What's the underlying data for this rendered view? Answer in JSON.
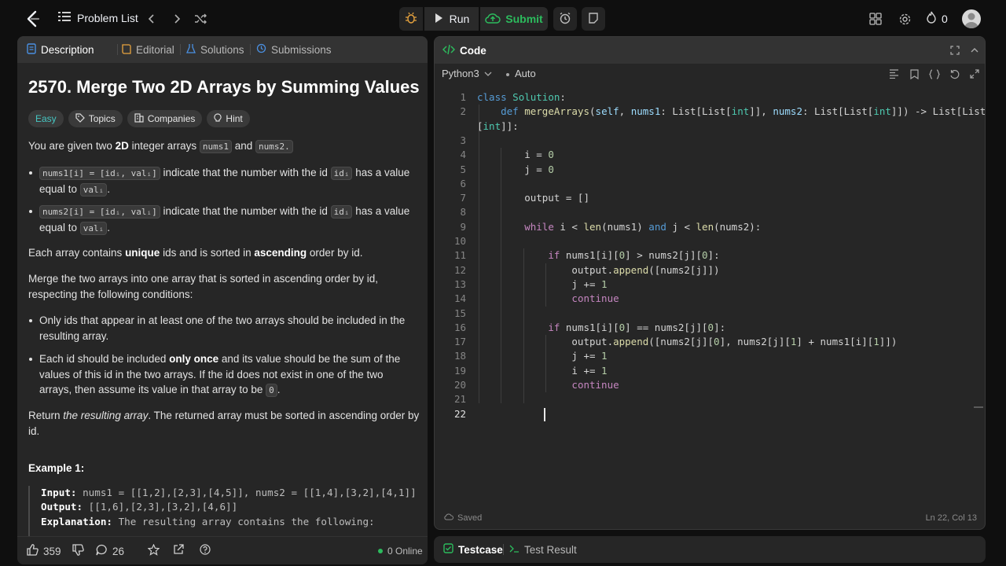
{
  "nav": {
    "problem_list": "Problem List",
    "run_label": "Run",
    "submit_label": "Submit",
    "streak": "0"
  },
  "tabs": {
    "description": "Description",
    "editorial": "Editorial",
    "solutions": "Solutions",
    "submissions": "Submissions"
  },
  "problem": {
    "title": "2570. Merge Two 2D Arrays by Summing Values",
    "difficulty": "Easy",
    "topics": "Topics",
    "companies": "Companies",
    "hint": "Hint",
    "p1_a": "You are given two ",
    "p1_b": "2D",
    "p1_c": " integer arrays ",
    "p1_code1": "nums1",
    "p1_d": " and ",
    "p1_code2": "nums2.",
    "b1_code": "nums1[i] = [idᵢ, valᵢ]",
    "b1_text": " indicate that the number with the id ",
    "b1_code2": "idᵢ",
    "b1_text2": " has a value equal to ",
    "b1_code3": "valᵢ",
    "b1_end": ".",
    "b2_code": "nums2[i] = [idᵢ, valᵢ]",
    "b2_text": " indicate that the number with the id ",
    "b2_code2": "idᵢ",
    "b2_text2": " has a value equal to ",
    "b2_code3": "valᵢ",
    "b2_end": ".",
    "p2_a": "Each array contains ",
    "p2_b": "unique",
    "p2_c": " ids and is sorted in ",
    "p2_d": "ascending",
    "p2_e": " order by id.",
    "p3": "Merge the two arrays into one array that is sorted in ascending order by id, respecting the following conditions:",
    "c1": "Only ids that appear in at least one of the two arrays should be included in the resulting array.",
    "c2_a": "Each id should be included ",
    "c2_b": "only once",
    "c2_c": " and its value should be the sum of the values of this id in the two arrays. If the id does not exist in one of the two arrays, then assume its value in that array to be ",
    "c2_code": "0",
    "c2_end": ".",
    "p4_a": "Return ",
    "p4_b": "the resulting array",
    "p4_c": ". The returned array must be sorted in ascending order by id.",
    "example_title": "Example 1:",
    "ex_input_label": "Input:",
    "ex_input": " nums1 = [[1,2],[2,3],[4,5]], nums2 = [[1,4],[3,2],[4,1]]",
    "ex_output_label": "Output:",
    "ex_output": " [[1,6],[2,3],[3,2],[4,6]]",
    "ex_expl_label": "Explanation:",
    "ex_expl": " The resulting array contains the following:"
  },
  "footer": {
    "likes": "359",
    "comments": "26",
    "online": "0 Online"
  },
  "code_panel": {
    "tab": "Code",
    "language": "Python3",
    "auto": "Auto",
    "saved": "Saved",
    "position": "Ln 22, Col 13"
  },
  "test_panel": {
    "testcase": "Testcase",
    "test_result": "Test Result"
  },
  "code_lines": [
    "1",
    "2",
    "",
    "3",
    "4",
    "5",
    "6",
    "7",
    "8",
    "9",
    "10",
    "11",
    "12",
    "13",
    "14",
    "15",
    "16",
    "17",
    "18",
    "19",
    "20",
    "21",
    "22"
  ]
}
